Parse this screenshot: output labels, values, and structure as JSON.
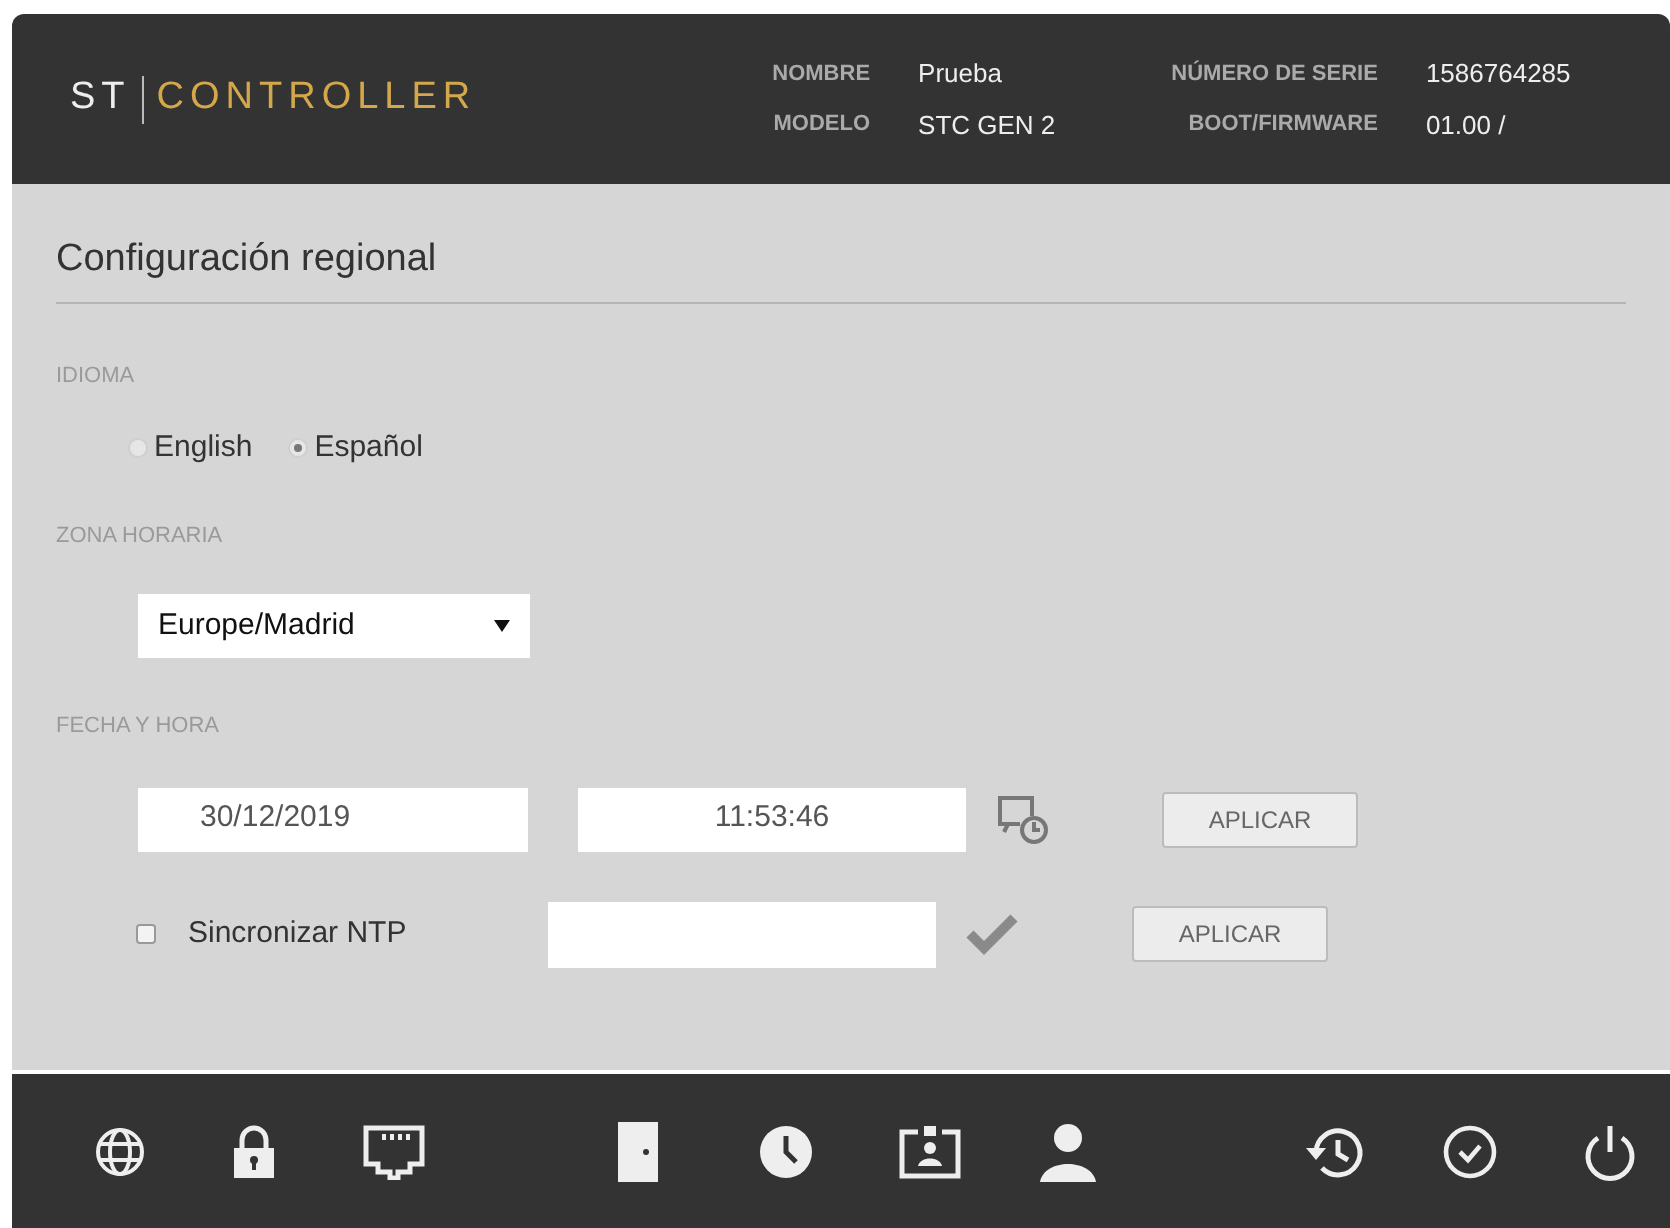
{
  "header": {
    "logo": {
      "prefix": "ST",
      "name": "CONTROLLER"
    },
    "fields": [
      {
        "label": "NOMBRE",
        "value": "Prueba"
      },
      {
        "label": "NÚMERO DE SERIE",
        "value": "1586764285"
      },
      {
        "label": "MODELO",
        "value": "STC GEN 2"
      },
      {
        "label": "BOOT/FIRMWARE",
        "value": "01.00 /"
      }
    ]
  },
  "section_title": "Configuración regional",
  "language": {
    "label": "IDIOMA",
    "options": [
      {
        "label": "English",
        "selected": false
      },
      {
        "label": "Español",
        "selected": true
      }
    ]
  },
  "timezone": {
    "label": "ZONA HORARIA",
    "value": "Europe/Madrid"
  },
  "datetime": {
    "label": "FECHA Y HORA",
    "date": "30/12/2019",
    "time": "11:53:46",
    "apply": "APLICAR"
  },
  "ntp": {
    "label": "Sincronizar NTP",
    "checked": false,
    "apply": "APLICAR"
  }
}
